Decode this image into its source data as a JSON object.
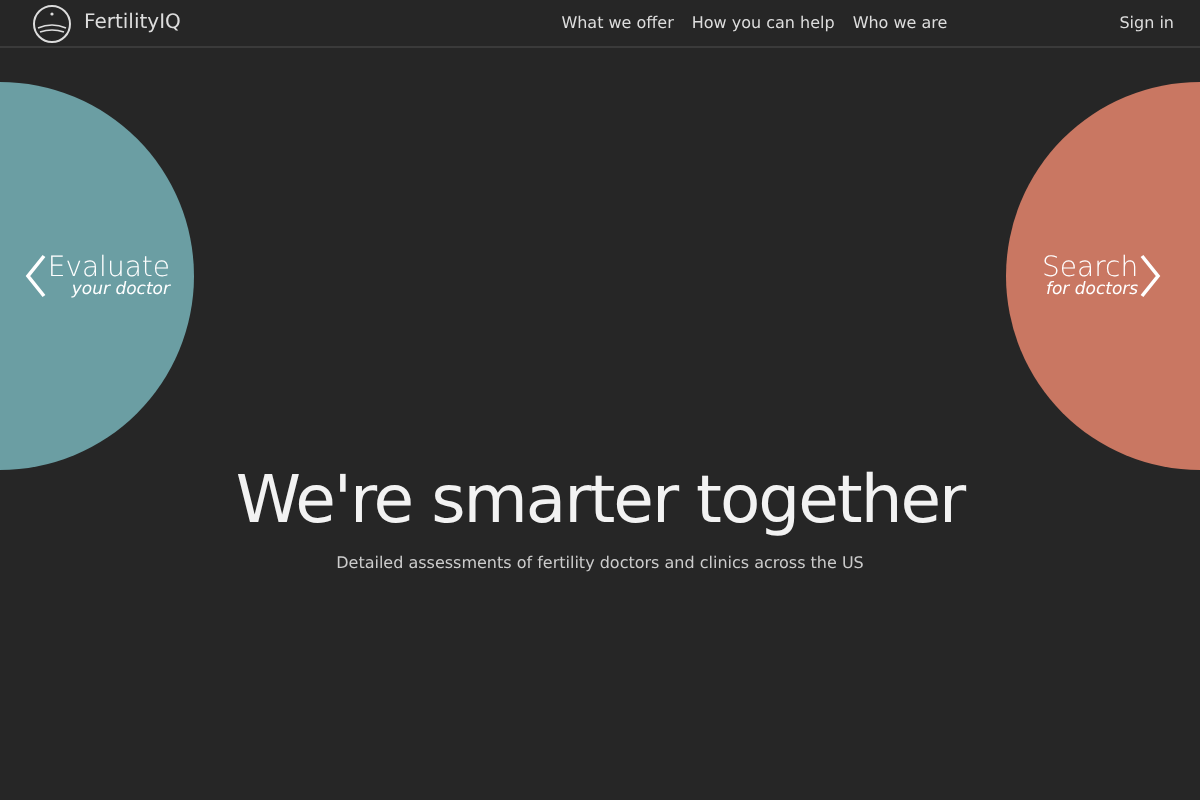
{
  "header": {
    "brand": "FertilityIQ",
    "nav": [
      {
        "label": "What we offer"
      },
      {
        "label": "How you can help"
      },
      {
        "label": "Who we are"
      }
    ],
    "sign_in": "Sign in"
  },
  "circles": [
    {
      "kind": "left",
      "title": "Evaluate",
      "subtitle": "your doctor",
      "color": "#6b9ea3"
    },
    {
      "kind": "right",
      "title": "Search",
      "subtitle": "for doctors",
      "color": "#c97762"
    }
  ],
  "hero": {
    "heading": "We're smarter together",
    "subheading": "Detailed assessments of fertility doctors and clinics across the US"
  }
}
